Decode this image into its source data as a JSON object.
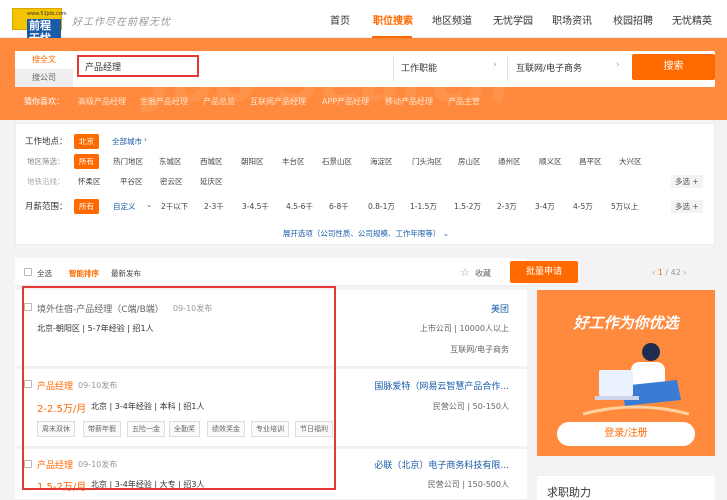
{
  "header": {
    "logo_url": "www.51job.com",
    "logo_text": "前程无忧",
    "slogan": "好工作尽在前程无忧",
    "nav": [
      "首页",
      "职位搜索",
      "地区频道",
      "无忧学园",
      "职场资讯",
      "校园招聘",
      "无忧精英"
    ],
    "active_nav": "职位搜索"
  },
  "search": {
    "tab_fulltext": "搜全文",
    "tab_company": "搜公司",
    "keyword": "产品经理",
    "function_select": "工作职能",
    "industry_select": "互联网/电子商务",
    "button": "搜索",
    "bg_text": "Job Search"
  },
  "hot": {
    "label": "猜你喜欢：",
    "items": [
      "高级产品经理",
      "金融产品经理",
      "产品总监",
      "互联网产品经理",
      "APP产品经理",
      "移动产品经理",
      "产品主管"
    ]
  },
  "filter": {
    "location_label": "工作地点：",
    "location_selected": "北京",
    "all_cities": "全部城市",
    "district_label": "地区筛选：",
    "districts_row1": [
      "所有",
      "热门地区",
      "东城区",
      "西城区",
      "朝阳区",
      "丰台区",
      "石景山区",
      "海淀区",
      "门头沟区",
      "房山区",
      "通州区",
      "顺义区",
      "昌平区",
      "大兴区"
    ],
    "subway_label": "地铁沿线：",
    "districts_row2": [
      "怀柔区",
      "平谷区",
      "密云区",
      "延庆区"
    ],
    "salary_label": "月薪范围：",
    "salaries": [
      "所有",
      "自定义",
      "2千以下",
      "2-3千",
      "3-4.5千",
      "4.5-6千",
      "6-8千",
      "0.8-1万",
      "1-1.5万",
      "1.5-2万",
      "2-3万",
      "3-4万",
      "4-5万",
      "5万以上"
    ],
    "more": "多选",
    "expand": "展开选项（公司性质、公司规模、工作年限等）"
  },
  "listbar": {
    "select_all": "全选",
    "sort_smart": "智能排序",
    "sort_latest": "最新发布",
    "fav": "收藏",
    "batch": "批量申请",
    "page_current": "1",
    "page_total": "/ 42"
  },
  "jobs": [
    {
      "title": "境外住宿-产品经理（C端/B端）",
      "published": "09-10发布",
      "info": "北京-朝阳区 | 5-7年经验 | 招1人",
      "salary": "",
      "company": "美团",
      "company_info": "上市公司 | 10000人以上",
      "industry": "互联网/电子商务",
      "tags": []
    },
    {
      "title": "产品经理",
      "published": "09-10发布",
      "info": "北京 | 3-4年经验 | 本科 | 招1人",
      "salary": "2-2.5万/月",
      "company": "国脉爱特（网易云智慧产品合作...",
      "company_info": "民营公司 | 50-150人",
      "industry": "",
      "tags": [
        "周末双休",
        "带薪年假",
        "五险一金",
        "全勤奖",
        "绩效奖金",
        "专业培训",
        "节日福利"
      ]
    },
    {
      "title": "产品经理",
      "published": "09-10发布",
      "info": "北京 | 3-4年经验 | 大专 | 招3人",
      "salary": "1.5-2万/月",
      "company": "必联（北京）电子商务科技有限...",
      "company_info": "民营公司 | 150-500人",
      "industry": "",
      "tags": []
    }
  ],
  "ad": {
    "title": "好工作为你优选",
    "button": "登录/注册"
  },
  "help": {
    "title": "求职助力"
  },
  "colors": {
    "accent": "#ff6a00",
    "hero": "#ff8a3d",
    "link": "#1a5ba8",
    "highlight": "#e53935"
  }
}
